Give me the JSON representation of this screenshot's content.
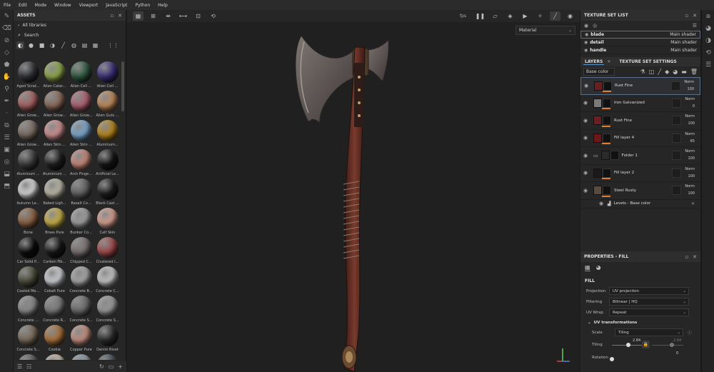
{
  "menu": [
    "File",
    "Edit",
    "Mode",
    "Window",
    "Viewport",
    "JavaScript",
    "Python",
    "Help"
  ],
  "assets": {
    "title": "ASSETS",
    "library": "All libraries",
    "search_label": "Search",
    "items": [
      {
        "label": "Aged Scrat...",
        "color": "#2f3034"
      },
      {
        "label": "Alien Cater...",
        "color": "#8fa84a"
      },
      {
        "label": "Alien Cell ...",
        "color": "#2f5a40"
      },
      {
        "label": "Alien Cell ...",
        "color": "#3a2f7a"
      },
      {
        "label": "Alien Grow...",
        "color": "#a86060"
      },
      {
        "label": "Alien Grow...",
        "color": "#8a6a58"
      },
      {
        "label": "Alien Grow...",
        "color": "#b06070"
      },
      {
        "label": "Alien Guts ...",
        "color": "#c08a58"
      },
      {
        "label": "Alien Grow...",
        "color": "#7a6a60"
      },
      {
        "label": "Alien Skin ...",
        "color": "#d09090"
      },
      {
        "label": "Alien Skin ...",
        "color": "#7aa8d0"
      },
      {
        "label": "Aluminum...",
        "color": "#b8861a"
      },
      {
        "label": "Aluminum ...",
        "color": "#3a3a3c"
      },
      {
        "label": "Aluminium ...",
        "color": "#1e1e20"
      },
      {
        "label": "Arch Finge...",
        "color": "#c88878"
      },
      {
        "label": "Artificial Le...",
        "color": "#141414"
      },
      {
        "label": "Autumn Le...",
        "color": "#d8d8d8"
      },
      {
        "label": "Baked Ligh...",
        "color": "#bdb8a8"
      },
      {
        "label": "Basalt Co...",
        "color": "#606060"
      },
      {
        "label": "Black Cast ...",
        "color": "#1c1c1c"
      },
      {
        "label": "Bone",
        "color": "#8a6040"
      },
      {
        "label": "Brass Pure",
        "color": "#c8b048"
      },
      {
        "label": "Bunker Co...",
        "color": "#a0a0a0"
      },
      {
        "label": "Calf Skin",
        "color": "#d8a090"
      },
      {
        "label": "Car Solid P...",
        "color": "#0a0a0a"
      },
      {
        "label": "Carbon Fib...",
        "color": "#161616"
      },
      {
        "label": "Chipped C...",
        "color": "#7a7070"
      },
      {
        "label": "Clustered I...",
        "color": "#a04848"
      },
      {
        "label": "Coated Me...",
        "color": "#4a4a38"
      },
      {
        "label": "Cobalt Pure",
        "color": "#d0d2d6"
      },
      {
        "label": "Concrete B...",
        "color": "#a8a8a8"
      },
      {
        "label": "Concrete C...",
        "color": "#c8c8c8"
      },
      {
        "label": "Concrete ...",
        "color": "#8a8a8a"
      },
      {
        "label": "Concrete R...",
        "color": "#7a7a7a"
      },
      {
        "label": "Concrete S...",
        "color": "#6a6a6a"
      },
      {
        "label": "Concrete S...",
        "color": "#9a9a9a"
      },
      {
        "label": "Concrete S...",
        "color": "#7a6a58"
      },
      {
        "label": "Cookie",
        "color": "#a87038"
      },
      {
        "label": "Copper Pure",
        "color": "#c89080"
      },
      {
        "label": "Denim Rivet",
        "color": "#2a2a2a"
      },
      {
        "label": "",
        "color": "#5a5a5a"
      },
      {
        "label": "",
        "color": "#c8b8a8"
      },
      {
        "label": "",
        "color": "#8a9aa8"
      },
      {
        "label": "",
        "color": "#3a4a58"
      }
    ]
  },
  "viewport": {
    "material_select": "Material"
  },
  "texture_sets": {
    "title": "TEXTURE SET LIST",
    "rows": [
      {
        "name": "blade",
        "shader": "Main shader"
      },
      {
        "name": "detail",
        "shader": "Main shader"
      },
      {
        "name": "handle",
        "shader": "Main shader"
      }
    ]
  },
  "layers": {
    "tab_layers": "LAYERS",
    "tab_settings": "TEXTURE SET SETTINGS",
    "channel": "Base color",
    "items": [
      {
        "name": "Rust Fine",
        "blend": "Norm",
        "opacity": "100",
        "thumb": "#6a2020",
        "selected": true
      },
      {
        "name": "Iron Galvanized",
        "blend": "Norm",
        "opacity": "0",
        "thumb": "#7a7a7a",
        "selected": false
      },
      {
        "name": "Rust Fine",
        "blend": "Norm",
        "opacity": "100",
        "thumb": "#6a2020",
        "selected": false
      },
      {
        "name": "Fill layer 4",
        "blend": "Norm",
        "opacity": "65",
        "thumb": "#6a1818",
        "selected": false
      },
      {
        "name": "Folder 1",
        "blend": "Norm",
        "opacity": "100",
        "thumb": "#2a2a2a",
        "selected": false
      },
      {
        "name": "Fill layer 2",
        "blend": "Norm",
        "opacity": "100",
        "thumb": "#1a1a1a",
        "selected": false
      },
      {
        "name": "Steel Rusty",
        "blend": "Norm",
        "opacity": "100",
        "thumb": "#5a4a40",
        "selected": false
      }
    ],
    "sub_effect": "Levels - Base color"
  },
  "properties": {
    "title": "PROPERTIES - FILL",
    "section": "FILL",
    "projection_label": "Projection",
    "projection_value": "UV projection",
    "filtering_label": "Filtering",
    "filtering_value": "Bilinear | HQ",
    "uvwrap_label": "UV Wrap",
    "uvwrap_value": "Repeat",
    "uv_transformations": "UV transformations",
    "scale_label": "Scale",
    "scale_value": "Tiling",
    "tiling_label": "Tiling",
    "tiling_value": "2.84",
    "tiling_value2": "2.84",
    "rotation_label": "Rotation",
    "rotation_value": "0"
  }
}
